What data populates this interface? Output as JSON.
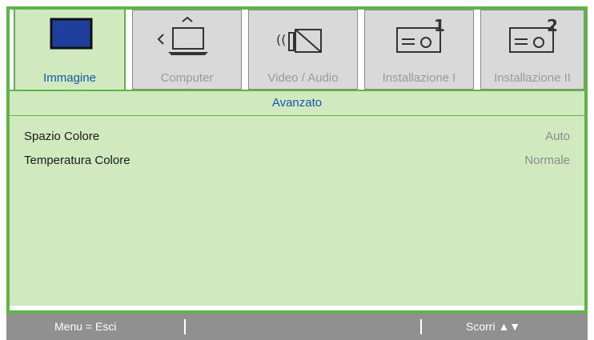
{
  "tabs": [
    {
      "label": "Immagine",
      "icon": "monitor-icon",
      "active": true
    },
    {
      "label": "Computer",
      "icon": "computer-icon",
      "active": false
    },
    {
      "label": "Video / Audio",
      "icon": "video-audio-icon",
      "active": false
    },
    {
      "label": "Installazione I",
      "icon": "projector-1-icon",
      "active": false
    },
    {
      "label": "Installazione II",
      "icon": "projector-2-icon",
      "active": false
    }
  ],
  "panel": {
    "subtitle": "Avanzato",
    "rows": [
      {
        "label": "Spazio Colore",
        "value": "Auto"
      },
      {
        "label": "Temperatura Colore",
        "value": "Normale"
      }
    ]
  },
  "footer": {
    "menu": "Menu = Esci",
    "scroll": "Scorri ▲▼"
  },
  "colors": {
    "accent": "#5cb544",
    "panel": "#d0e9bf",
    "active_label": "#1a55a6",
    "footer": "#909090"
  }
}
